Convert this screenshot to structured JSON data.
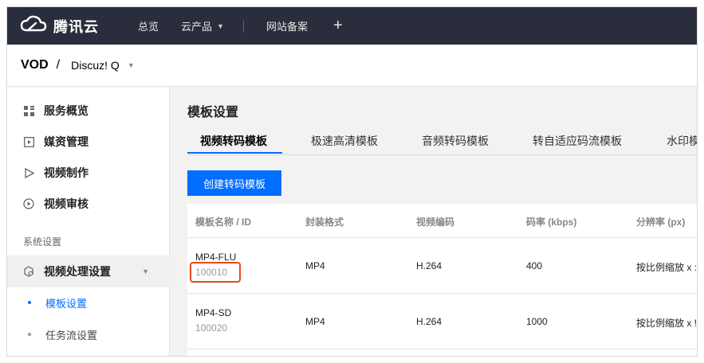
{
  "topbar": {
    "logo_icon": "cloud-logo-icon",
    "brand": "腾讯云",
    "nav": [
      {
        "label": "总览"
      },
      {
        "label": "云产品",
        "has_caret": true
      },
      {
        "label": "网站备案"
      }
    ],
    "plus_icon": "plus-icon",
    "plus": "+"
  },
  "product": {
    "name": "VOD",
    "separator": "/",
    "app": "Discuz! Q"
  },
  "sidebar": {
    "items": [
      {
        "label": "服务概览",
        "icon": "grid-icon"
      },
      {
        "label": "媒资管理",
        "icon": "media-icon"
      },
      {
        "label": "视频制作",
        "icon": "play-outline-icon"
      },
      {
        "label": "视频审核",
        "icon": "review-icon"
      }
    ],
    "group_label": "系统设置",
    "settings": {
      "label": "视频处理设置",
      "icon": "settings-gear-icon"
    },
    "sub_items": [
      {
        "label": "模板设置",
        "active": true
      },
      {
        "label": "任务流设置",
        "active": false
      }
    ],
    "accent_color": "#006eff"
  },
  "main": {
    "title": "模板设置",
    "tabs": [
      {
        "label": "视频转码模板",
        "active": true
      },
      {
        "label": "极速高清模板"
      },
      {
        "label": "音频转码模板"
      },
      {
        "label": "转自适应码流模板"
      },
      {
        "label": "水印模"
      }
    ],
    "create_button": "创建转码模板",
    "table": {
      "headers": [
        "模板名称 / ID",
        "封装格式",
        "视频编码",
        "码率 (kbps)",
        "分辨率 (px)"
      ],
      "rows": [
        {
          "name": "MP4-FLU",
          "id": "100010",
          "format": "MP4",
          "codec": "H.264",
          "bitrate": "400",
          "resolution": "按比例缩放 x :",
          "id_highlighted": true
        },
        {
          "name": "MP4-SD",
          "id": "100020",
          "format": "MP4",
          "codec": "H.264",
          "bitrate": "1000",
          "resolution": "按比例缩放 x !"
        }
      ]
    },
    "highlight_color": "#e8481b"
  }
}
